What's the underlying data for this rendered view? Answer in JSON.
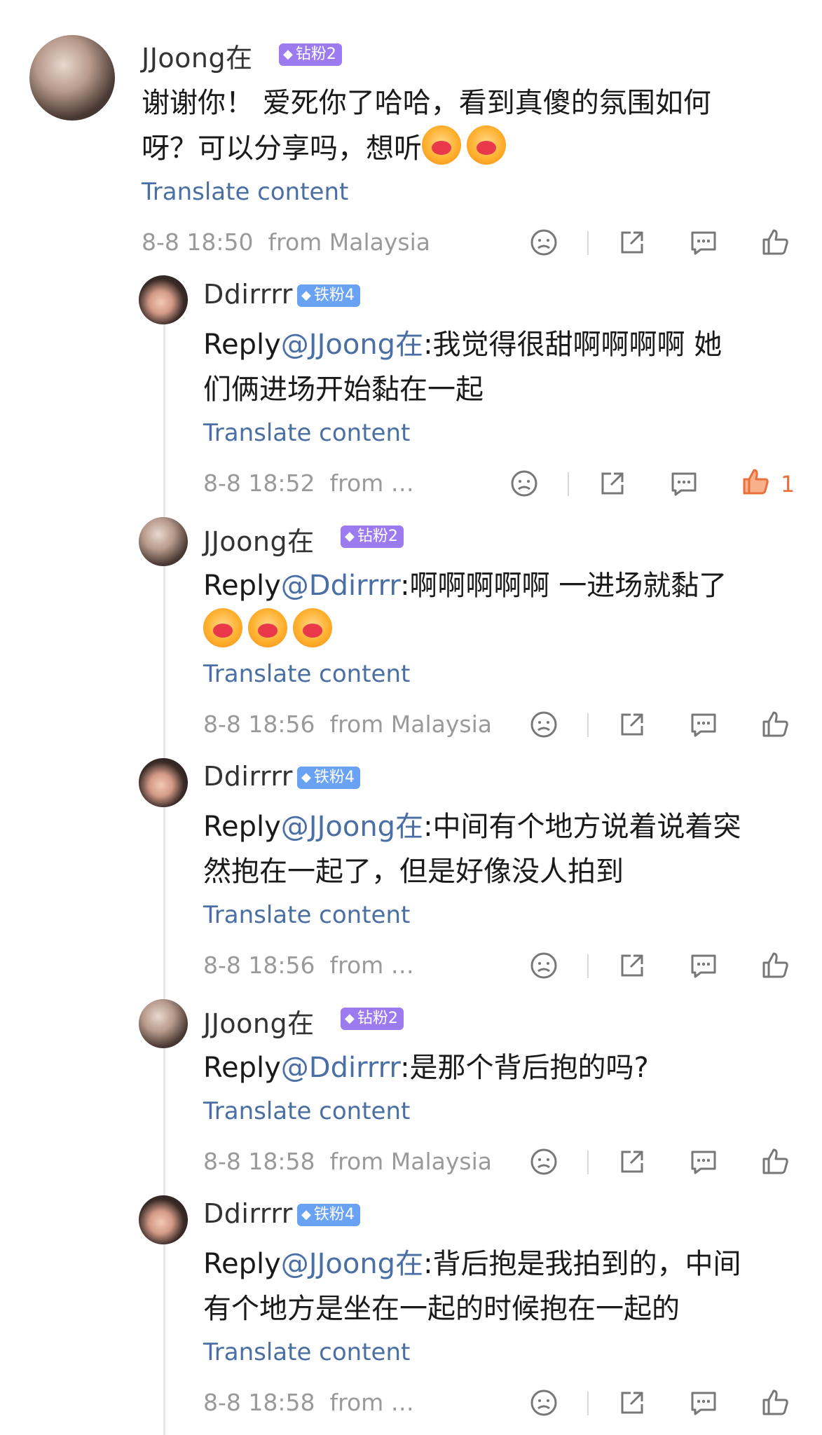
{
  "comments": [
    {
      "user": "JJoong在",
      "badge": "钻粉2",
      "pre": "",
      "mention": "",
      "text_lines": [
        "谢谢你！ 爱死你了哈哈，看到真傻的氛围如何",
        "呀？可以分享吗，想听"
      ],
      "emojis": 2,
      "translate": "Translate content",
      "time": "8-8 18:50",
      "from": "from Malaysia"
    },
    {
      "user": "Ddirrrr",
      "badge": "铁粉4",
      "pre": "Reply",
      "mention": "@JJoong在",
      "text_lines": [
        ":我觉得很甜啊啊啊啊 她",
        "们俩进场开始黏在一起"
      ],
      "translate": "Translate content",
      "time": "8-8 18:52",
      "from": "from …",
      "likes": "1"
    },
    {
      "user": "JJoong在",
      "badge": "钻粉2",
      "pre": "Reply",
      "mention": "@Ddirrrr",
      "text_lines": [
        ":啊啊啊啊啊 一进场就黏了"
      ],
      "emojis": 3,
      "translate": "Translate content",
      "time": "8-8 18:56",
      "from": "from Malaysia"
    },
    {
      "user": "Ddirrrr",
      "badge": "铁粉4",
      "pre": "Reply",
      "mention": "@JJoong在",
      "text_lines": [
        ":中间有个地方说着说着突",
        "然抱在一起了，但是好像没人拍到"
      ],
      "translate": "Translate content",
      "time": "8-8 18:56",
      "from": "from …"
    },
    {
      "user": "JJoong在",
      "badge": "钻粉2",
      "pre": "Reply",
      "mention": "@Ddirrrr",
      "text_lines": [
        ":是那个背后抱的吗?"
      ],
      "translate": "Translate content",
      "time": "8-8 18:58",
      "from": "from Malaysia"
    },
    {
      "user": "Ddirrrr",
      "badge": "铁粉4",
      "pre": "Reply",
      "mention": "@JJoong在",
      "text_lines": [
        ":背后抱是我拍到的，中间",
        "有个地方是坐在一起的时候抱在一起的"
      ],
      "translate": "Translate content",
      "time": "8-8 18:58",
      "from": "from …"
    }
  ],
  "colors": {
    "link": "#4a6fa5",
    "diamond_badge": "#9c7bf0",
    "iron_badge": "#6aa2f3",
    "liked": "#e8703a"
  },
  "icons": [
    "dislike-icon",
    "share-icon",
    "reply-icon",
    "like-icon"
  ]
}
